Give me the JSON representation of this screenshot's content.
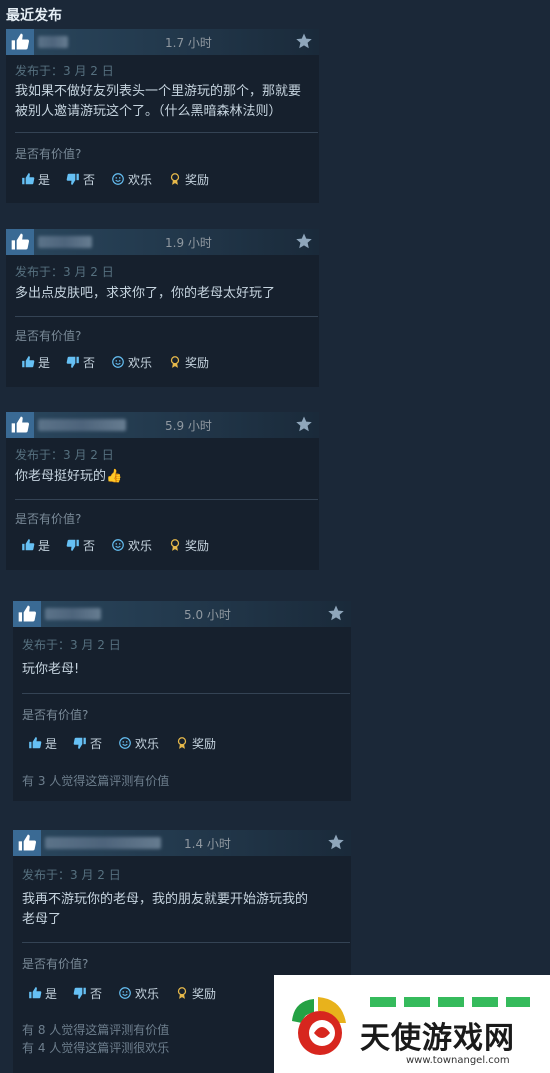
{
  "section_title": "最近发布",
  "colors": {
    "accent": "#66c0f4",
    "award": "#e6b84a",
    "background": "#1b2838"
  },
  "reviews": [
    {
      "hours": "1.7 小时",
      "posted": "发布于：3 月 2 日",
      "content": "我如果不做好友列表头一个里游玩的那个，那就要\n被别人邀请游玩这个了。（什么黑暗森林法则）",
      "helpful_question": "是否有价值?",
      "yes": "是",
      "no": "否",
      "funny": "欢乐",
      "award": "奖励",
      "stats": []
    },
    {
      "hours": "1.9 小时",
      "posted": "发布于：3 月 2 日",
      "content": "多出点皮肤吧，求求你了，你的老母太好玩了",
      "helpful_question": "是否有价值?",
      "yes": "是",
      "no": "否",
      "funny": "欢乐",
      "award": "奖励",
      "stats": []
    },
    {
      "hours": "5.9 小时",
      "posted": "发布于：3 月 2 日",
      "content": "你老母挺好玩的👍",
      "helpful_question": "是否有价值?",
      "yes": "是",
      "no": "否",
      "funny": "欢乐",
      "award": "奖励",
      "stats": []
    },
    {
      "hours": "5.0 小时",
      "posted": "发布于：3 月 2 日",
      "content": "玩你老母!",
      "helpful_question": "是否有价值?",
      "yes": "是",
      "no": "否",
      "funny": "欢乐",
      "award": "奖励",
      "stats": [
        "有 3 人觉得这篇评测有价值"
      ]
    },
    {
      "hours": "1.4 小时",
      "posted": "发布于：3 月 2 日",
      "content": "我再不游玩你的老母，我的朋友就要开始游玩我的\n老母了",
      "helpful_question": "是否有价值?",
      "yes": "是",
      "no": "否",
      "funny": "欢乐",
      "award": "奖励",
      "stats": [
        "有 8 人觉得这篇评测有价值",
        "有 4 人觉得这篇评测很欢乐"
      ]
    }
  ],
  "watermark": {
    "text": "天使游戏网",
    "url": "www.townangel.com"
  }
}
